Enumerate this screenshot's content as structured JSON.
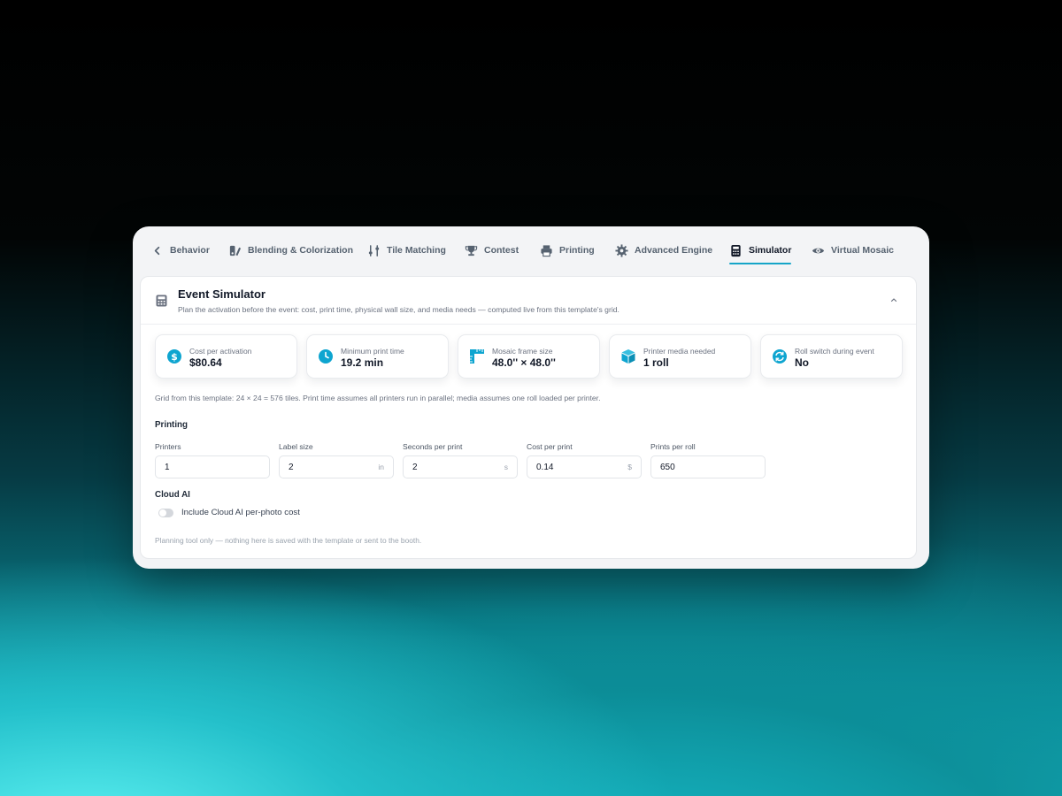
{
  "tabs": [
    {
      "label": "Behavior",
      "icon": "chevron-left-icon"
    },
    {
      "label": "Blending & Colorization",
      "icon": "palette-icon"
    },
    {
      "label": "Tile Matching",
      "icon": "sliders-icon"
    },
    {
      "label": "Contest",
      "icon": "trophy-icon"
    },
    {
      "label": "Printing",
      "icon": "printer-icon"
    },
    {
      "label": "Advanced Engine",
      "icon": "gear-icon"
    },
    {
      "label": "Simulator",
      "icon": "calculator-icon",
      "active": true
    },
    {
      "label": "Virtual Mosaic",
      "icon": "eye-icon"
    }
  ],
  "card": {
    "title": "Event Simulator",
    "subtitle": "Plan the activation before the event: cost, print time, physical wall size, and media needs — computed live from this template's grid."
  },
  "stats": [
    {
      "label": "Cost per activation",
      "value": "$80.64",
      "icon": "dollar-icon"
    },
    {
      "label": "Minimum print time",
      "value": "19.2 min",
      "icon": "clock-icon"
    },
    {
      "label": "Mosaic frame size",
      "value": "48.0'' × 48.0''",
      "icon": "ruler-icon"
    },
    {
      "label": "Printer media needed",
      "value": "1 roll",
      "icon": "box-icon"
    },
    {
      "label": "Roll switch during event",
      "value": "No",
      "icon": "refresh-icon"
    }
  ],
  "grid_note": "Grid from this template: 24 × 24 = 576 tiles. Print time assumes all printers run in parallel; media assumes one roll loaded per printer.",
  "printing": {
    "heading": "Printing",
    "fields": [
      {
        "label": "Printers",
        "value": "1",
        "unit": ""
      },
      {
        "label": "Label size",
        "value": "2",
        "unit": "in"
      },
      {
        "label": "Seconds per print",
        "value": "2",
        "unit": "s"
      },
      {
        "label": "Cost per print",
        "value": "0.14",
        "unit": "$"
      },
      {
        "label": "Prints per roll",
        "value": "650",
        "unit": ""
      }
    ]
  },
  "cloud_ai": {
    "heading": "Cloud AI",
    "toggle_label": "Include Cloud AI per-photo cost",
    "enabled": false
  },
  "footer_note": "Planning tool only — nothing here is saved with the template or sent to the booth.",
  "colors": {
    "accent": "#16a5c8",
    "icon": "#0ea5d0"
  }
}
